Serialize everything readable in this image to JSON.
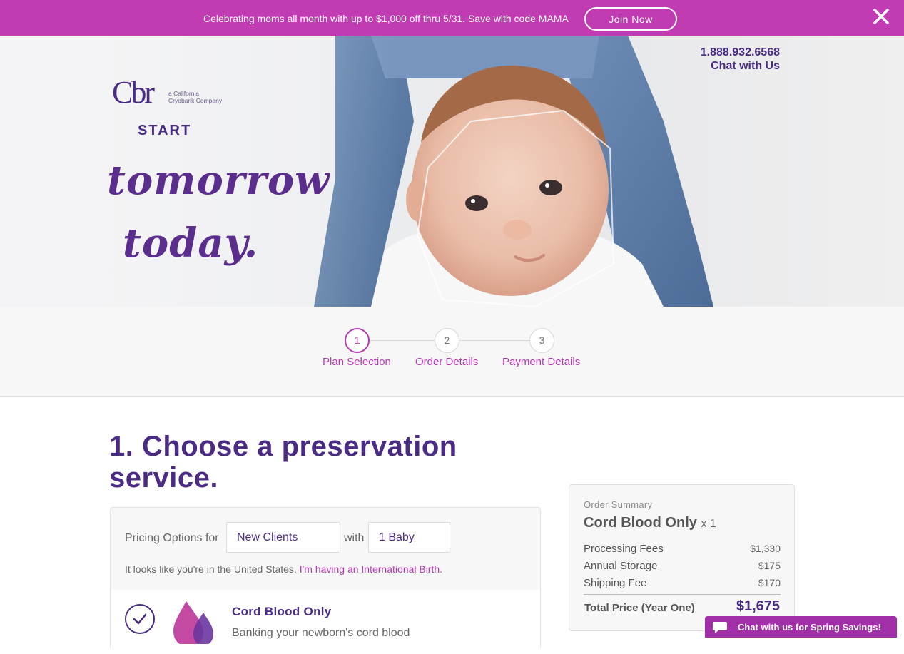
{
  "promo": {
    "text": "Celebrating moms all month with up to $1,000 off thru 5/31. Save with code MAMA",
    "button": "Join Now"
  },
  "header": {
    "logo_mark": "Cbr",
    "logo_sub_1": "a California",
    "logo_sub_2": "Cryobank Company",
    "phone": "1.888.932.6568",
    "chat": "Chat with Us"
  },
  "hero": {
    "start": "START",
    "line1": "tomorrow",
    "line2": "today."
  },
  "steps": [
    {
      "number": "1",
      "label": "Plan Selection",
      "active": true
    },
    {
      "number": "2",
      "label": "Order Details",
      "active": false
    },
    {
      "number": "3",
      "label": "Payment Details",
      "active": false
    }
  ],
  "main": {
    "heading_line1": "1. Choose a preservation",
    "heading_line2": "service.",
    "pricing_label": "Pricing Options for",
    "client_type": "New Clients",
    "with_label": "with",
    "baby_count": "1 Baby",
    "location_note": "It looks like you're in the United States.",
    "intl_link": "I'm having an International Birth.",
    "plan_title": "Cord Blood Only",
    "plan_desc": "Banking your newborn's cord blood"
  },
  "summary": {
    "label": "Order Summary",
    "plan": "Cord Blood Only",
    "qty": "x 1",
    "rows": [
      {
        "name": "Processing Fees",
        "amount": "$1,330"
      },
      {
        "name": "Annual Storage",
        "amount": "$175"
      },
      {
        "name": "Shipping Fee",
        "amount": "$170"
      }
    ],
    "total_label": "Total Price (Year One)",
    "total": "$1,675"
  },
  "chat_widget": {
    "text": "Chat with us for Spring Savings!"
  },
  "colors": {
    "promo_bg": "#c13bb2",
    "brand_purple": "#4b2c84",
    "accent_magenta": "#b43ab2",
    "chat_bg": "#a12fa8"
  }
}
